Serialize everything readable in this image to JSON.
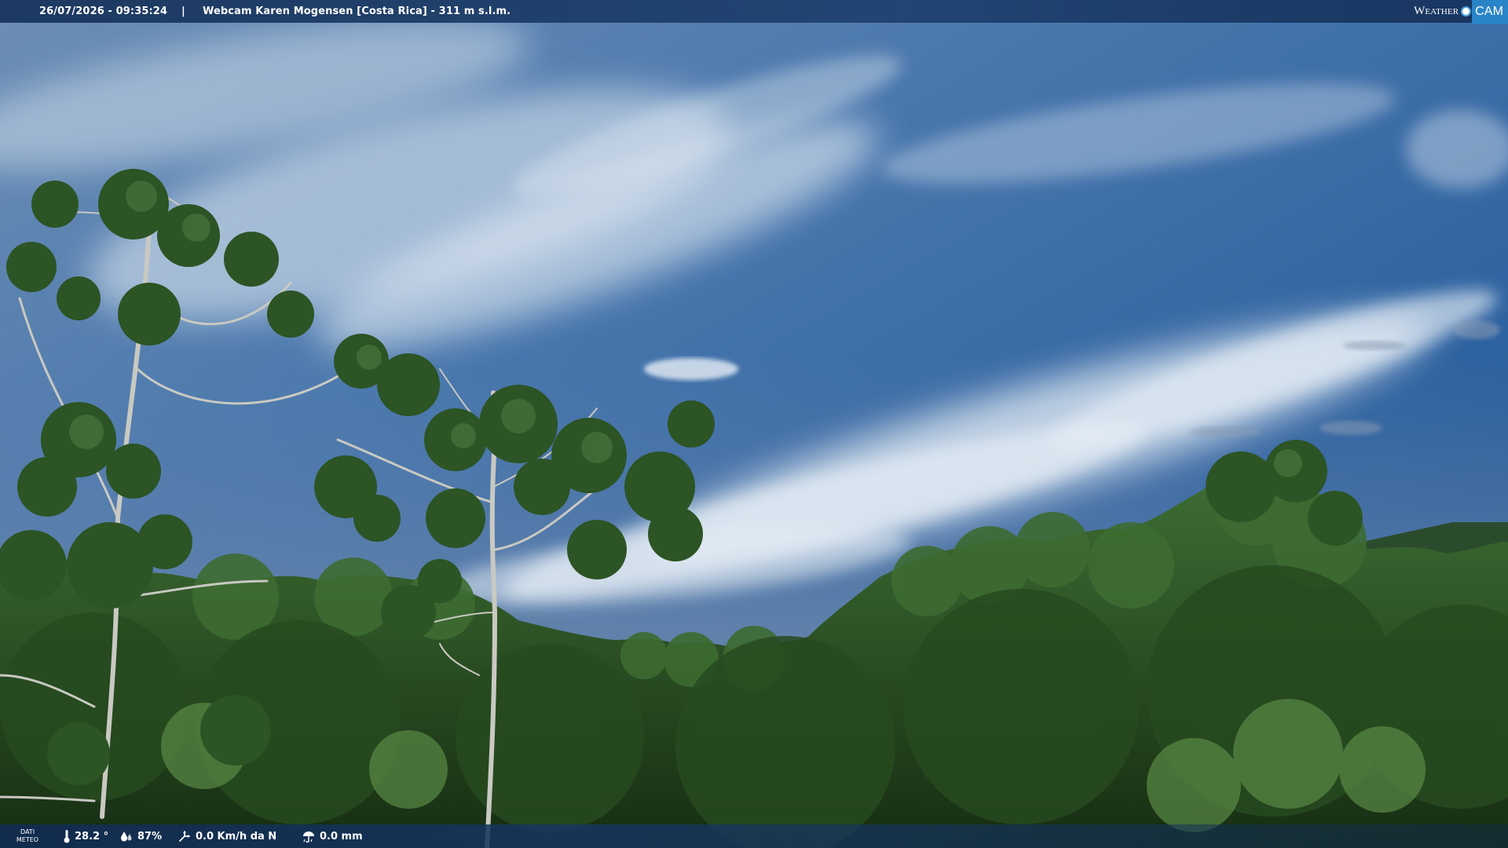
{
  "header": {
    "datetime": "26/07/2026 - 09:35:24",
    "separator": "|",
    "camera_title": "Webcam Karen Mogensen [Costa Rica]  - 311 m s.l.m.",
    "brand_weather": "Weather",
    "brand_cam": "CAM"
  },
  "footer": {
    "label_line1": "DATI",
    "label_line2": "METEO",
    "temperature": "28.2 °",
    "humidity": "87%",
    "wind": "0.0 Km/h da N",
    "rain": "0.0 mm"
  },
  "icons": {
    "temperature": "thermometer-icon",
    "humidity": "humidity-drops-icon",
    "wind": "wind-direction-icon",
    "rain": "rain-gauge-icon",
    "brand": "weather-sun-icon"
  },
  "colors": {
    "sky_top": "#1f4f86",
    "sky_mid": "#4a78ad",
    "cloud": "#e3ecf4",
    "forest_dark": "#1a3314",
    "forest_mid": "#2f5a27",
    "forest_light": "#4b7d3a",
    "bar": "#18365e",
    "brand_blue": "#2a84c8"
  }
}
